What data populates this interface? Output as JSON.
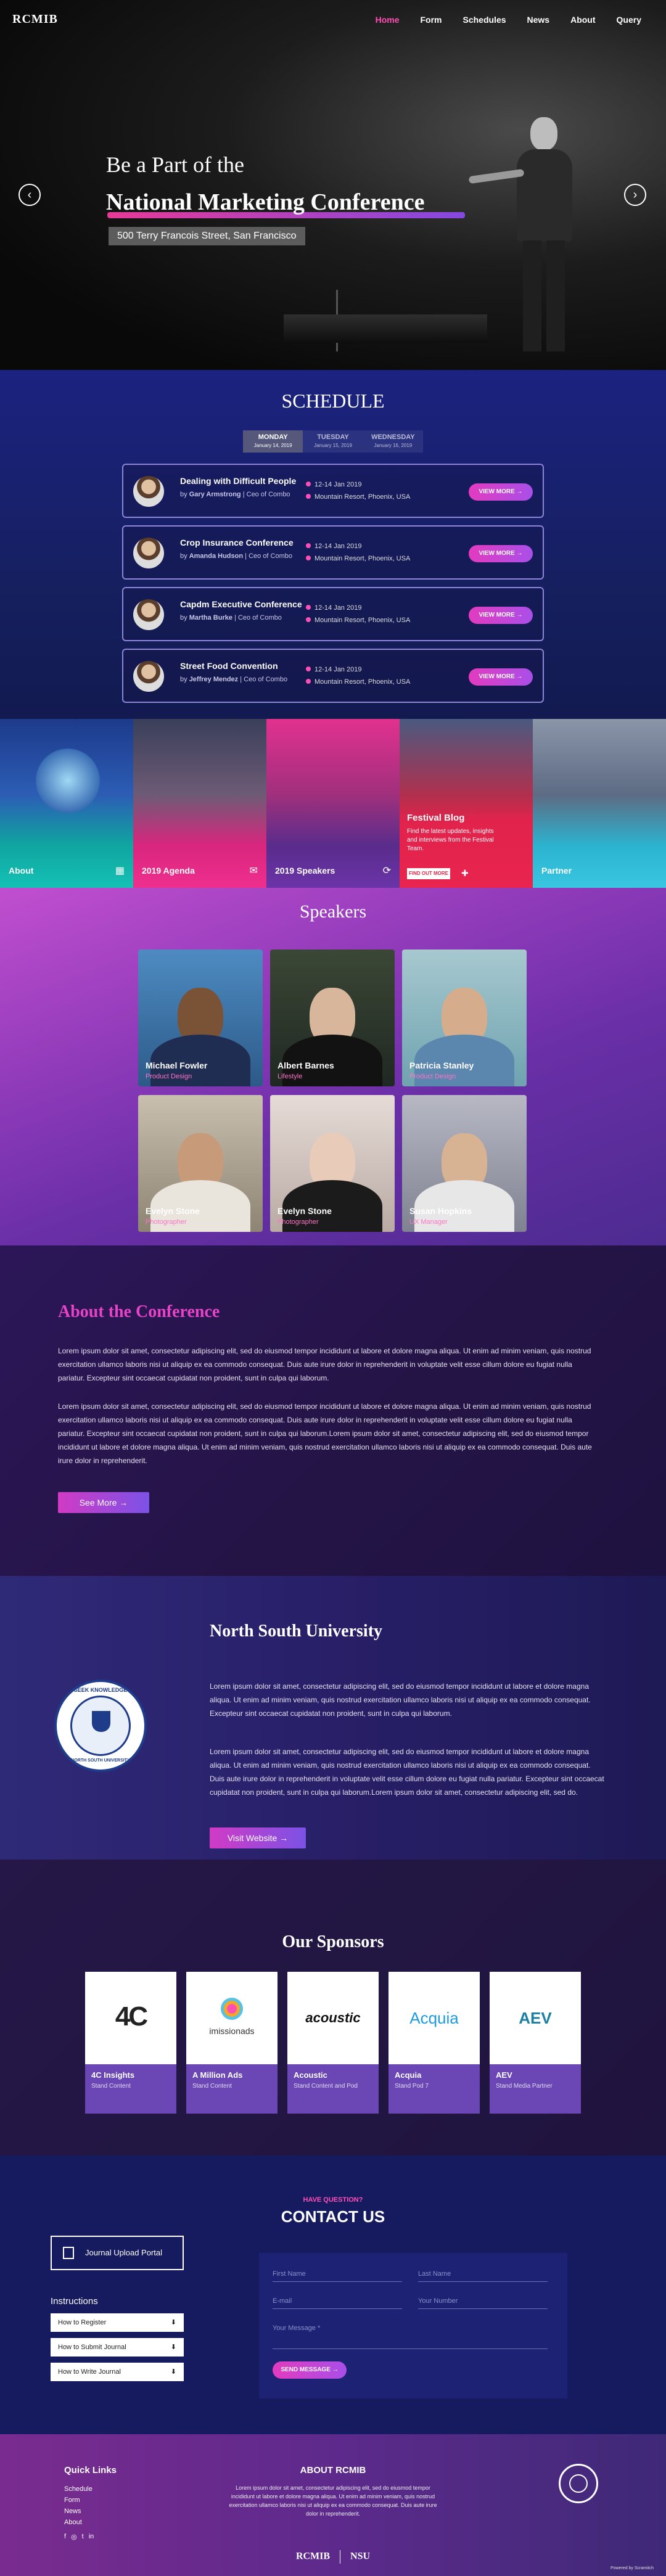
{
  "nav": {
    "logo": "RCMIB",
    "items": [
      "Home",
      "Form",
      "Schedules",
      "News",
      "About",
      "Query"
    ],
    "active": "Home"
  },
  "hero": {
    "line1": "Be a Part of the",
    "line2": "National Marketing Conference",
    "address": "500 Terry Francois Street, San Francisco",
    "prev": "‹",
    "next": "›"
  },
  "schedule": {
    "title": "SCHEDULE",
    "tabs": [
      {
        "label": "MONDAY",
        "date": "January 14, 2019"
      },
      {
        "label": "TUESDAY",
        "date": "January 15, 2019"
      },
      {
        "label": "WEDNESDAY",
        "date": "January 16, 2019"
      }
    ],
    "events": [
      {
        "title": "Dealing with Difficult People",
        "by": "by",
        "speaker": "Gary Armstrong",
        "role": "Ceo of Combo",
        "date": "12-14 Jan 2019",
        "place": "Mountain Resort, Phoenix, USA",
        "button": "VIEW MORE →"
      },
      {
        "title": "Crop Insurance Conference",
        "by": "by",
        "speaker": "Amanda Hudson",
        "role": "Ceo of Combo",
        "date": "12-14 Jan 2019",
        "place": "Mountain Resort, Phoenix, USA",
        "button": "VIEW MORE →"
      },
      {
        "title": "Capdm Executive Conference",
        "by": "by",
        "speaker": "Martha Burke",
        "role": "Ceo of Combo",
        "date": "12-14 Jan 2019",
        "place": "Mountain Resort, Phoenix, USA",
        "button": "VIEW MORE →"
      },
      {
        "title": "Street Food Convention",
        "by": "by",
        "speaker": "Jeffrey Mendez",
        "role": "Ceo of Combo",
        "date": "12-14 Jan 2019",
        "place": "Mountain Resort, Phoenix, USA",
        "button": "VIEW MORE →"
      }
    ]
  },
  "tiles": [
    {
      "label": "About",
      "icon": "▦"
    },
    {
      "label": "2019 Agenda",
      "icon": "✉"
    },
    {
      "label": "2019 Speakers",
      "icon": "⟳"
    },
    {
      "label": "Festival Blog",
      "text": "Find the latest updates, insights and interviews from the Festival Team.",
      "button": "FIND OUT MORE",
      "icon": "✚"
    },
    {
      "label": "Partner",
      "icon": ""
    }
  ],
  "speakers": {
    "title": "Speakers",
    "people": [
      {
        "name": "Michael Fowler",
        "role": "Product Design"
      },
      {
        "name": "Albert Barnes",
        "role": "Lifestyle"
      },
      {
        "name": "Patricia Stanley",
        "role": "Product Design"
      },
      {
        "name": "Evelyn Stone",
        "role": "Photographer"
      },
      {
        "name": "Evelyn Stone",
        "role": "Photographer"
      },
      {
        "name": "Susan Hopkins",
        "role": "UX Manager"
      }
    ]
  },
  "about": {
    "title": "About the Conference",
    "p1": "Lorem ipsum dolor sit amet, consectetur adipiscing elit, sed do eiusmod tempor incididunt ut labore et dolore magna aliqua. Ut enim ad minim veniam, quis nostrud exercitation ullamco laboris nisi ut aliquip ex ea commodo consequat. Duis aute irure dolor in reprehenderit in voluptate velit esse cillum dolore eu fugiat nulla pariatur. Excepteur sint occaecat cupidatat non proident, sunt in culpa qui laborum.",
    "p2": "Lorem ipsum dolor sit amet, consectetur adipiscing elit, sed do eiusmod tempor incididunt ut labore et dolore magna aliqua. Ut enim ad minim veniam, quis nostrud exercitation ullamco laboris nisi ut aliquip ex ea commodo consequat. Duis aute irure dolor in reprehenderit in voluptate velit esse cillum dolore eu fugiat nulla pariatur. Excepteur sint occaecat cupidatat non proident, sunt in culpa qui laborum.Lorem ipsum dolor sit amet, consectetur adipiscing elit, sed do eiusmod tempor incididunt ut labore et dolore magna aliqua. Ut enim ad minim veniam, quis nostrud exercitation ullamco laboris nisi ut aliquip ex ea commodo consequat. Duis aute irure dolor in reprehenderit.",
    "button": "See More →"
  },
  "nsu": {
    "title": "North South University",
    "seal_top": "SEEK KNOWLEDGE",
    "seal_bottom": "NORTH SOUTH UNIVERSITY",
    "p1": "Lorem ipsum dolor sit amet, consectetur adipiscing elit, sed do eiusmod tempor incididunt ut labore et dolore magna aliqua. Ut enim ad minim veniam, quis nostrud exercitation ullamco laboris nisi ut aliquip ex ea commodo consequat. Excepteur sint occaecat cupidatat non proident, sunt in culpa qui laborum.",
    "p2": "Lorem ipsum dolor sit amet, consectetur adipiscing elit, sed do eiusmod tempor incididunt ut labore et dolore magna aliqua. Ut enim ad minim veniam, quis nostrud exercitation ullamco laboris nisi ut aliquip ex ea commodo consequat. Duis aute irure dolor in reprehenderit in voluptate velit esse cillum dolore eu fugiat nulla pariatur. Excepteur sint occaecat cupidatat non proident, sunt in culpa qui laborum.Lorem ipsum dolor sit amet, consectetur adipiscing elit, sed do.",
    "button": "Visit Website →"
  },
  "sponsors": {
    "title": "Our Sponsors",
    "items": [
      {
        "logo": "4C",
        "name": "4C Insights",
        "role": "Stand Content"
      },
      {
        "logo": "imissionads",
        "name": "A Million Ads",
        "role": "Stand Content"
      },
      {
        "logo": "acoustic",
        "name": "Acoustic",
        "role": "Stand Content and Pod"
      },
      {
        "logo": "Acquia",
        "name": "Acquia",
        "role": "Stand Pod 7"
      },
      {
        "logo": "AEV",
        "name": "AEV",
        "role": "Stand Media Partner"
      }
    ]
  },
  "contact": {
    "kicker": "HAVE QUESTION?",
    "title": "CONTACT US",
    "portal": "Journal Upload Portal",
    "instructions_title": "Instructions",
    "instructions": [
      "How to Register",
      "How to Submit Journal",
      "How to Write Journal"
    ],
    "fields": {
      "first": "First Name",
      "last": "Last Name",
      "email": "E-mail",
      "phone": "Your Number",
      "message": "Your Message *"
    },
    "send": "SEND MESSAGE →"
  },
  "footer": {
    "quick_title": "Quick Links",
    "links": [
      "Schedule",
      "Form",
      "News",
      "About"
    ],
    "about_title": "ABOUT RCMIB",
    "about_text": "Lorem ipsum dolor sit amet, consectetur adipiscing elit, sed do eiusmod tempor incididunt ut labore et dolore magna aliqua. Ut enim ad minim veniam, quis nostrud exercitation ullamco laboris nisi ut aliquip ex ea commodo consequat. Duis aute irure dolor in reprehenderit.",
    "brand1": "RCMIB",
    "brand2": "NSU",
    "social": [
      "f",
      "◎",
      "t",
      "in"
    ],
    "credit": "Powered by Scramitch"
  },
  "colors": {
    "accent": "#ff4fb7",
    "purple": "#8d4cf5",
    "navy": "#161a5e"
  }
}
